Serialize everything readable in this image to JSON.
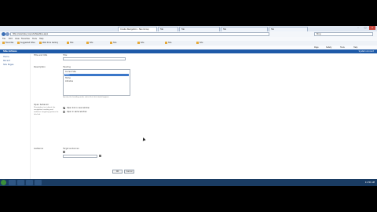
{
  "browser": {
    "tabs": [
      {
        "label": "Create Navigation - Nav Group"
      },
      {
        "label": "Tab"
      },
      {
        "label": "Tab"
      },
      {
        "label": "Tab"
      },
      {
        "label": "Tab"
      }
    ],
    "address": "http://example/_layouts/NewNav.aspx",
    "search_placeholder": "Bing",
    "menu": [
      "File",
      "Edit",
      "View",
      "Favorites",
      "Tools",
      "Help"
    ],
    "favorites": [
      "Favorites",
      "Suggested Sites",
      "Web Slice Gallery",
      "Site",
      "Site",
      "Site",
      "Site",
      "Site",
      "Site"
    ],
    "commands": [
      "Page",
      "Safety",
      "Tools",
      "Help"
    ],
    "window_controls": {
      "minimize": "–",
      "maximize": "□",
      "close": "×"
    }
  },
  "ribbon": {
    "title": "Site Actions",
    "user": "System Account"
  },
  "leftnav": [
    "Home",
    "Recent",
    "Site Pages"
  ],
  "form": {
    "title_label": "Title and URL",
    "title_field_label": "Title:",
    "title_value": "",
    "audience_label": "Description",
    "list_label": "Heading",
    "list_options": [
      "Current Site",
      "Sites",
      "Home",
      "Libraries"
    ],
    "list_selected_index": 2,
    "info_text": "Specify the heading under which this link should appear.",
    "desc_text": "Description text about the navigation heading and audience targeting options for this link.",
    "open_label": "Open behavior",
    "radio_options": [
      "Open link in new window",
      "Open in same window"
    ],
    "radio_selected_index": 0,
    "audience_section_label": "Audience",
    "audience_hint": "Target audiences:",
    "ok_label": "OK",
    "cancel_label": "Cancel"
  },
  "status": {
    "left": "Done",
    "right": "Local intranet | Protected Mode: Off",
    "zoom": "100%"
  },
  "taskbar": {
    "clock": "11:30 AM"
  }
}
